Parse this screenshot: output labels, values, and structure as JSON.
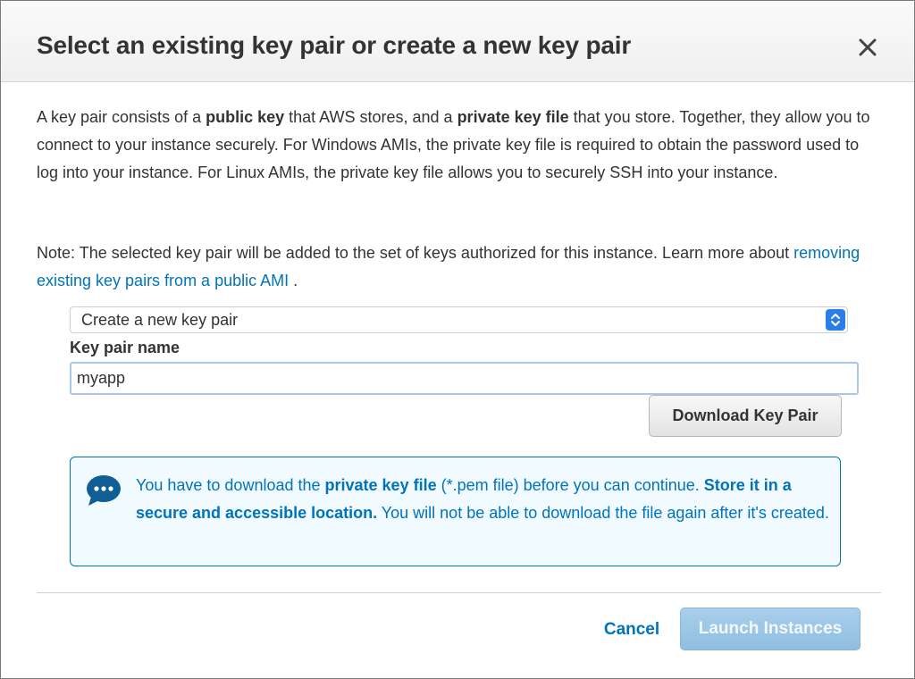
{
  "dialog": {
    "title": "Select an existing key pair or create a new key pair",
    "intro": {
      "t1": "A key pair consists of a ",
      "b1": "public key",
      "t2": " that AWS stores, and a ",
      "b2": "private key file",
      "t3": " that you store. Together, they allow you to connect to your instance securely. For Windows AMIs, the private key file is required to obtain the password used to log into your instance. For Linux AMIs, the private key file allows you to securely SSH into your instance."
    },
    "note": {
      "t1": "Note: The selected key pair will be added to the set of keys authorized for this instance. Learn more about ",
      "link": "removing existing key pairs from a public AMI",
      "t2": " ."
    },
    "key_pair_select": {
      "selected": "Create a new key pair"
    },
    "key_pair_name": {
      "label": "Key pair name",
      "value": "myapp"
    },
    "download_button": "Download Key Pair",
    "alert": {
      "t1": "You have to download the ",
      "b1": "private key file",
      "t2": " (*.pem file) before you can continue. ",
      "b2": "Store it in a secure and accessible location.",
      "t3": " You will not be able to download the file again after it's created."
    },
    "cancel_button": "Cancel",
    "launch_button": "Launch Instances"
  },
  "icons": {
    "close": "close-icon",
    "select_arrows": "chevron-up-down-icon",
    "alert": "chat-bubble-icon"
  },
  "colors": {
    "link": "#0073bb",
    "alert_bg": "#f1faff",
    "alert_border": "#0073bb",
    "launch_disabled": "#9fc8e8",
    "select_accent": "#2b7de9"
  }
}
